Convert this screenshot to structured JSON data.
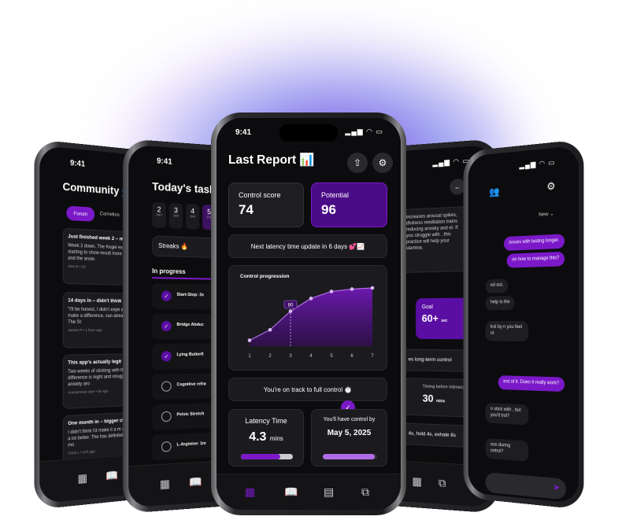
{
  "colors": {
    "accent": "#7b19c8",
    "accent_light": "#b06ce6",
    "bg": "#0c0c0e",
    "card": "#1b1b1f"
  },
  "status": {
    "time": "9:41"
  },
  "forum": {
    "title": "Community",
    "tabs": [
      "Forum",
      "Cornelius"
    ],
    "posts": [
      {
        "title": "Just finished week 2 – ma",
        "body": "Week 2 down. The Kegel exer but starting to show result more control, and the anxie",
        "meta": "Alex B • 2d"
      },
      {
        "title": "14 days in – didn't think it'd",
        "body": "\"I'll be honest, I didn't expe actually make a difference, can already feel it. The St",
        "meta": "James R • 1 hour ago"
      },
      {
        "title": "This app's actually legit",
        "body": "Two weeks of sticking with the difference is night and struggled with anxiety aro",
        "meta": "Anonymous user • 5h ago"
      },
      {
        "title": "One month in – bigger che",
        "body": "I didn't think I'd make it a m and feeling a lot better. The has definitely given me mo",
        "meta": "Chris L • 12h ago"
      }
    ]
  },
  "tasks": {
    "title": "Today's tasks",
    "days": [
      {
        "n": "2",
        "m": "Jan"
      },
      {
        "n": "3",
        "m": "Jan"
      },
      {
        "n": "4",
        "m": "Jan"
      },
      {
        "n": "5",
        "m": "Jan"
      }
    ],
    "streaks": "Streaks 🔥",
    "section": "In progress",
    "items": [
      {
        "label": "Start-Stop: 3x",
        "done": true
      },
      {
        "label": "Bridge Abduc",
        "done": true
      },
      {
        "label": "Lying Butterfl",
        "done": true
      },
      {
        "label": "Cognitive refra",
        "done": false
      },
      {
        "label": "Pelvic Stretch",
        "done": false
      },
      {
        "label": "L-Arginine: 1m",
        "done": false
      }
    ]
  },
  "report": {
    "title": "Last Report 📊",
    "control_label": "Control score",
    "control_value": "74",
    "potential_label": "Potential",
    "potential_value": "96",
    "latency_update": "Next latency time update in 6 days 💕📈",
    "chart_title": "Control progression",
    "track_text": "You're on track to full control ⏱️",
    "latency_label": "Latency Time",
    "latency_value": "4.3",
    "latency_unit": "mins",
    "control_by_label": "You'll have control by",
    "control_by_date": "May 5, 2025"
  },
  "chart_data": {
    "type": "area",
    "title": "Control progression",
    "x": [
      1,
      2,
      3,
      4,
      5,
      6,
      7
    ],
    "y": [
      10,
      28,
      60,
      82,
      94,
      98,
      100
    ],
    "highlight": {
      "x": 3,
      "label": "80"
    },
    "progress": {
      "latency_fraction": 0.75,
      "control_fraction": 0.95
    }
  },
  "learn": {
    "body": "increases arousal spikes, dfulness meditation trains reducing anxiety and el. If you struggle with , this practice will help your stamina.",
    "goal_label": "Goal",
    "goal_value": "60+",
    "goal_unit": "sec",
    "long_term": "es long-term control",
    "timing_label": "Timing before intimacy",
    "timing_value": "30",
    "timing_unit": "mins",
    "breath": "4s, hold 4s, exhale 8s"
  },
  "chat": {
    "filter": "New",
    "messages": [
      {
        "text": "issues with lasting longer.",
        "me": true
      },
      {
        "text": "on how to manage this?",
        "me": true
      },
      {
        "text": "ed out.",
        "me": false
      },
      {
        "text": "help is the",
        "me": false
      },
      {
        "text": "trol by n you feel ol.",
        "me": false
      },
      {
        "text": "erd of it. Does it really work?",
        "me": true
      },
      {
        "text": "o stick with , but you'll trol?",
        "me": false
      },
      {
        "text": "ous during ontrol?",
        "me": false
      }
    ]
  }
}
